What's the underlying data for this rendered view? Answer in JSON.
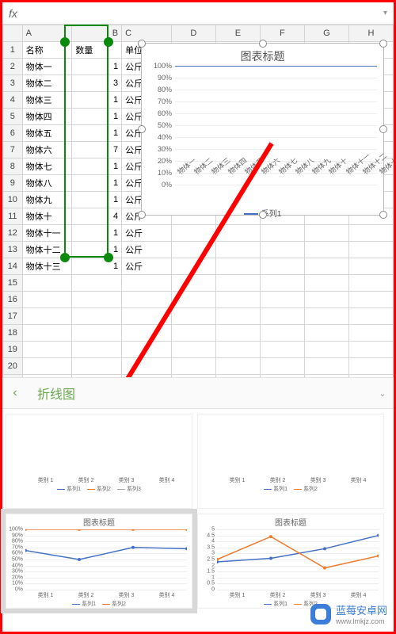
{
  "formula_bar": {
    "fx": "fx"
  },
  "columns": [
    "A",
    "B",
    "C",
    "D",
    "E",
    "F",
    "G",
    "H"
  ],
  "row_count": 24,
  "headers": {
    "name": "名称",
    "qty": "数量",
    "unit": "单位"
  },
  "rows": [
    {
      "name": "物体一",
      "qty": 1,
      "unit": "公斤"
    },
    {
      "name": "物体二",
      "qty": 3,
      "unit": "公斤"
    },
    {
      "name": "物体三",
      "qty": 1,
      "unit": "公斤"
    },
    {
      "name": "物体四",
      "qty": 1,
      "unit": "公斤"
    },
    {
      "name": "物体五",
      "qty": 1,
      "unit": "公斤"
    },
    {
      "name": "物体六",
      "qty": 7,
      "unit": "公斤"
    },
    {
      "name": "物体七",
      "qty": 1,
      "unit": "公斤"
    },
    {
      "name": "物体八",
      "qty": 1,
      "unit": "公斤"
    },
    {
      "name": "物体九",
      "qty": 1,
      "unit": "公斤"
    },
    {
      "name": "物体十",
      "qty": 4,
      "unit": "公斤"
    },
    {
      "name": "物体十一",
      "qty": 1,
      "unit": "公斤"
    },
    {
      "name": "物体十二",
      "qty": 1,
      "unit": "公斤"
    },
    {
      "name": "物体十三",
      "qty": 1,
      "unit": "公斤"
    }
  ],
  "chart": {
    "title": "图表标题",
    "legend": "系列1",
    "y_ticks": [
      "100%",
      "90%",
      "80%",
      "70%",
      "60%",
      "50%",
      "40%",
      "30%",
      "20%",
      "10%",
      "0%"
    ]
  },
  "chart_data": {
    "type": "line",
    "title": "图表标题",
    "categories": [
      "物体一",
      "物体二",
      "物体三",
      "物体四",
      "物体五",
      "物体六",
      "物体七",
      "物体八",
      "物体九",
      "物体十",
      "物体十一",
      "物体十二",
      "物体十三"
    ],
    "series": [
      {
        "name": "系列1",
        "values": [
          100,
          100,
          100,
          100,
          100,
          100,
          100,
          100,
          100,
          100,
          100,
          100,
          100
        ]
      }
    ],
    "ylabel": "",
    "xlabel": "",
    "ylim": [
      0,
      100
    ],
    "y_format": "percent"
  },
  "chart_type_panel": {
    "label": "折线图"
  },
  "previews": [
    {
      "id": "top-left",
      "categories": [
        "类别 1",
        "类别 2",
        "类别 3",
        "类别 4"
      ],
      "legend": [
        "系列1",
        "系列2",
        "系列3"
      ],
      "colors": [
        "#4472c4",
        "#ed7d31",
        "#a5a5a5"
      ]
    },
    {
      "id": "top-right",
      "categories": [
        "类别 1",
        "类别 2",
        "类别 3",
        "类别 4"
      ],
      "legend": [
        "系列1",
        "系列2"
      ],
      "colors": [
        "#4472c4",
        "#ed7d31"
      ]
    },
    {
      "id": "bottom-left",
      "title": "图表标题",
      "selected": true,
      "y_ticks": [
        "100%",
        "90%",
        "80%",
        "70%",
        "60%",
        "50%",
        "40%",
        "30%",
        "20%",
        "10%",
        "0%"
      ],
      "categories": [
        "类别 1",
        "类别 2",
        "类别 3",
        "类别 4"
      ],
      "legend": [
        "系列1",
        "系列2"
      ],
      "colors": [
        "#4472c4",
        "#ed7d31"
      ],
      "series": [
        {
          "name": "系列1",
          "values": [
            65,
            50,
            70,
            68
          ],
          "color": "#4472c4"
        },
        {
          "name": "系列2",
          "values": [
            100,
            100,
            100,
            100
          ],
          "color": "#ed7d31"
        }
      ]
    },
    {
      "id": "bottom-right",
      "title": "图表标题",
      "y_ticks": [
        "5",
        "4.5",
        "4",
        "3.5",
        "3",
        "2.5",
        "2",
        "1.5",
        "1",
        "0.5",
        "0"
      ],
      "categories": [
        "类别 1",
        "类别 2",
        "类别 3",
        "类别 4"
      ],
      "legend": [
        "系列1",
        "系列2"
      ],
      "colors": [
        "#4472c4",
        "#ed7d31"
      ],
      "series": [
        {
          "name": "系列1",
          "values": [
            2.3,
            2.6,
            3.4,
            4.5
          ],
          "color": "#4472c4"
        },
        {
          "name": "系列2",
          "values": [
            2.5,
            4.4,
            1.8,
            2.8
          ],
          "color": "#ed7d31"
        }
      ]
    }
  ],
  "watermark": {
    "brand": "蓝莓安卓网",
    "url": "www.lmkjz.com"
  }
}
